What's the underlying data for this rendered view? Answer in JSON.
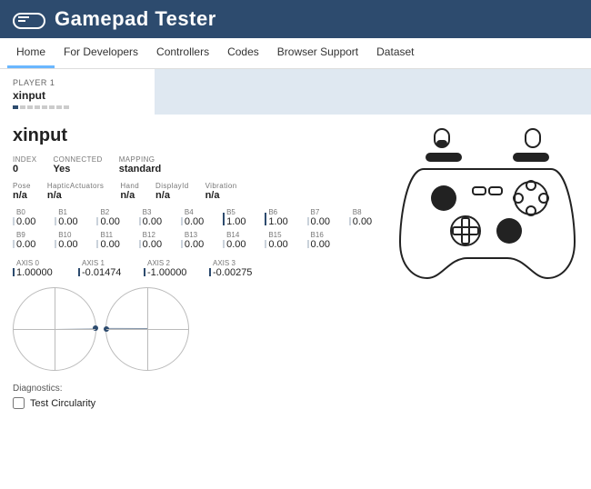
{
  "header": {
    "title": "Gamepad Tester"
  },
  "nav": {
    "tabs": [
      "Home",
      "For Developers",
      "Controllers",
      "Codes",
      "Browser Support",
      "Dataset"
    ],
    "active_index": 0
  },
  "player_card": {
    "label": "PLAYER 1",
    "name": "xinput"
  },
  "device": {
    "name": "xinput",
    "meta": [
      {
        "label": "INDEX",
        "value": "0"
      },
      {
        "label": "CONNECTED",
        "value": "Yes"
      },
      {
        "label": "MAPPING",
        "value": "standard"
      }
    ],
    "extended": [
      {
        "label": "Pose",
        "value": "n/a"
      },
      {
        "label": "HapticActuators",
        "value": "n/a"
      },
      {
        "label": "Hand",
        "value": "n/a"
      },
      {
        "label": "DisplayId",
        "value": "n/a"
      },
      {
        "label": "Vibration",
        "value": "n/a"
      }
    ],
    "buttons": [
      {
        "label": "B0",
        "value": "0.00",
        "pressed": false
      },
      {
        "label": "B1",
        "value": "0.00",
        "pressed": false
      },
      {
        "label": "B2",
        "value": "0.00",
        "pressed": false
      },
      {
        "label": "B3",
        "value": "0.00",
        "pressed": false
      },
      {
        "label": "B4",
        "value": "0.00",
        "pressed": false
      },
      {
        "label": "B5",
        "value": "1.00",
        "pressed": true
      },
      {
        "label": "B6",
        "value": "1.00",
        "pressed": true
      },
      {
        "label": "B7",
        "value": "0.00",
        "pressed": false
      },
      {
        "label": "B8",
        "value": "0.00",
        "pressed": false
      },
      {
        "label": "B9",
        "value": "0.00",
        "pressed": false
      },
      {
        "label": "B10",
        "value": "0.00",
        "pressed": false
      },
      {
        "label": "B11",
        "value": "0.00",
        "pressed": false
      },
      {
        "label": "B12",
        "value": "0.00",
        "pressed": false
      },
      {
        "label": "B13",
        "value": "0.00",
        "pressed": false
      },
      {
        "label": "B14",
        "value": "0.00",
        "pressed": false
      },
      {
        "label": "B15",
        "value": "0.00",
        "pressed": false
      },
      {
        "label": "B16",
        "value": "0.00",
        "pressed": false
      }
    ],
    "axes": [
      {
        "label": "AXIS 0",
        "value": "1.00000",
        "num": 1.0
      },
      {
        "label": "AXIS 1",
        "value": "-0.01474",
        "num": -0.01474
      },
      {
        "label": "AXIS 2",
        "value": "-1.00000",
        "num": -1.0
      },
      {
        "label": "AXIS 3",
        "value": "-0.00275",
        "num": -0.00275
      }
    ]
  },
  "diagnostics": {
    "heading": "Diagnostics:",
    "test_circularity": "Test Circularity"
  },
  "colors": {
    "navbar": "#2d4b6e",
    "accent": "#6ab7ff"
  }
}
